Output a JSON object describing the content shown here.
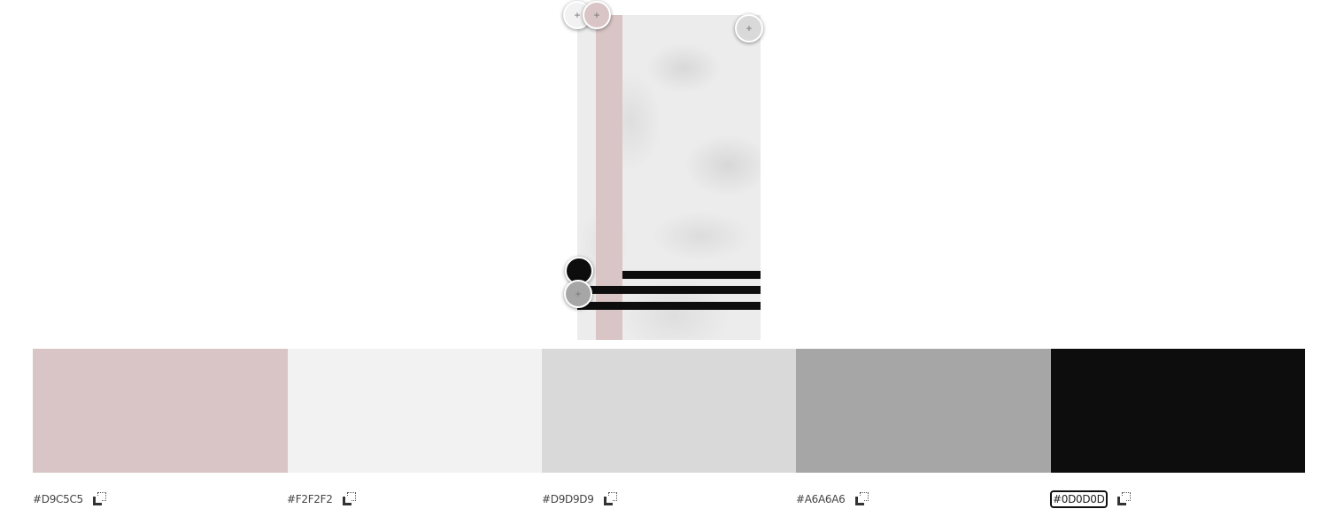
{
  "image": {
    "name": "marble-photo-with-stripes"
  },
  "pickers": [
    {
      "name": "picker-f2f2f2",
      "color": "#F2F2F2",
      "symbol": "+"
    },
    {
      "name": "picker-d9c5c5",
      "color": "#D9C5C5",
      "symbol": "+"
    },
    {
      "name": "picker-d9d9d9",
      "color": "#D9D9D9",
      "symbol": "+"
    },
    {
      "name": "picker-0d0d0d",
      "color": "#0D0D0D",
      "symbol": ""
    },
    {
      "name": "picker-a6a6a6",
      "color": "#A6A6A6",
      "symbol": "+"
    }
  ],
  "swatches": [
    {
      "hex": "#D9C5C5",
      "color": "#D9C5C5",
      "selected": false
    },
    {
      "hex": "#F2F2F2",
      "color": "#F2F2F2",
      "selected": false
    },
    {
      "hex": "#D9D9D9",
      "color": "#D9D9D9",
      "selected": false
    },
    {
      "hex": "#A6A6A6",
      "color": "#A6A6A6",
      "selected": false
    },
    {
      "hex": "#0D0D0D",
      "color": "#0D0D0D",
      "selected": true
    }
  ],
  "icons": {
    "copy": "copy-icon"
  }
}
